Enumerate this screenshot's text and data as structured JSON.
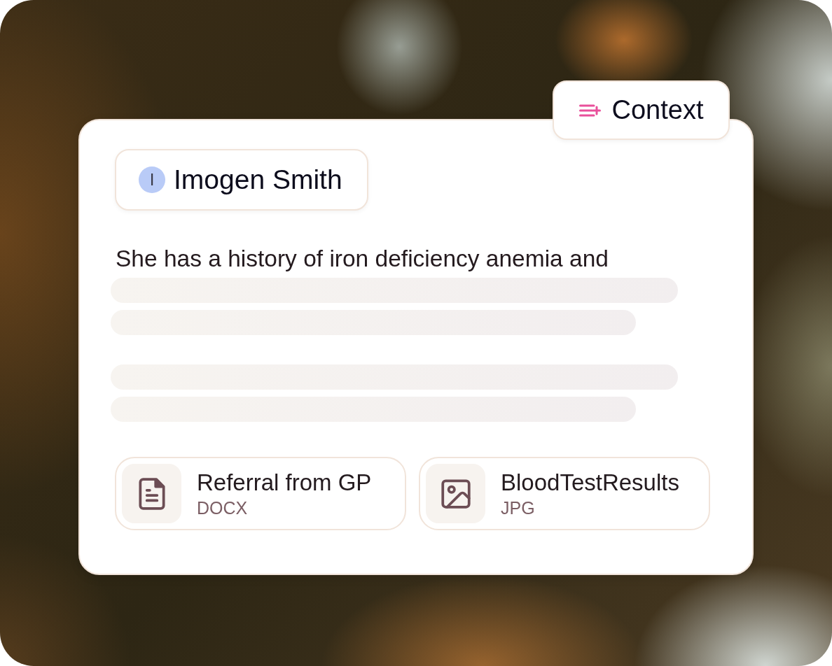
{
  "context_button": {
    "label": "Context"
  },
  "patient_chip": {
    "initial": "I",
    "name": "Imogen Smith"
  },
  "note": {
    "text": "She has a history of iron deficiency anemia and"
  },
  "attachments": [
    {
      "kind": "document",
      "name": "Referral from GP",
      "type": "DOCX"
    },
    {
      "kind": "image",
      "name": "BloodTestResults",
      "type": "JPG"
    }
  ]
}
